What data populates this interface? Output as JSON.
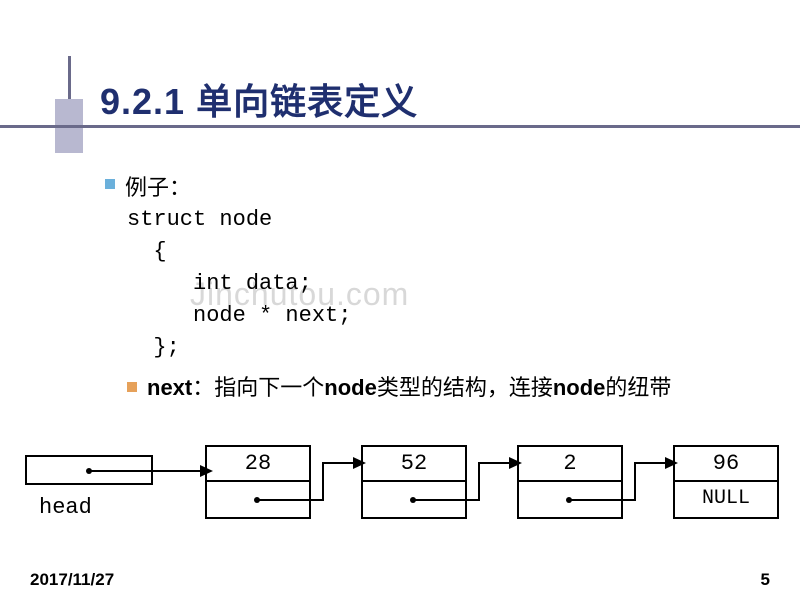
{
  "title": "9.2.1 单向链表定义",
  "example_label": "例子：",
  "code": "struct node\n  {\n     int data;\n     node * next;\n  };",
  "sub_bullet_html": "next：指向下一个node类型的结构，连接node的纽带",
  "sub_bullet_prefix": "next",
  "sub_bullet_mid1": "：指向下一个",
  "sub_bullet_b1": "node",
  "sub_bullet_mid2": "类型的结构，连接",
  "sub_bullet_b2": "node",
  "sub_bullet_tail": "的纽带",
  "watermark": "Jinchutou.com",
  "diagram": {
    "head_label": "head",
    "nodes": [
      {
        "data": "28",
        "ptr": ""
      },
      {
        "data": "52",
        "ptr": ""
      },
      {
        "data": "2",
        "ptr": ""
      },
      {
        "data": "96",
        "ptr": "NULL"
      }
    ]
  },
  "footer": {
    "date": "2017/11/27",
    "page": "5"
  }
}
